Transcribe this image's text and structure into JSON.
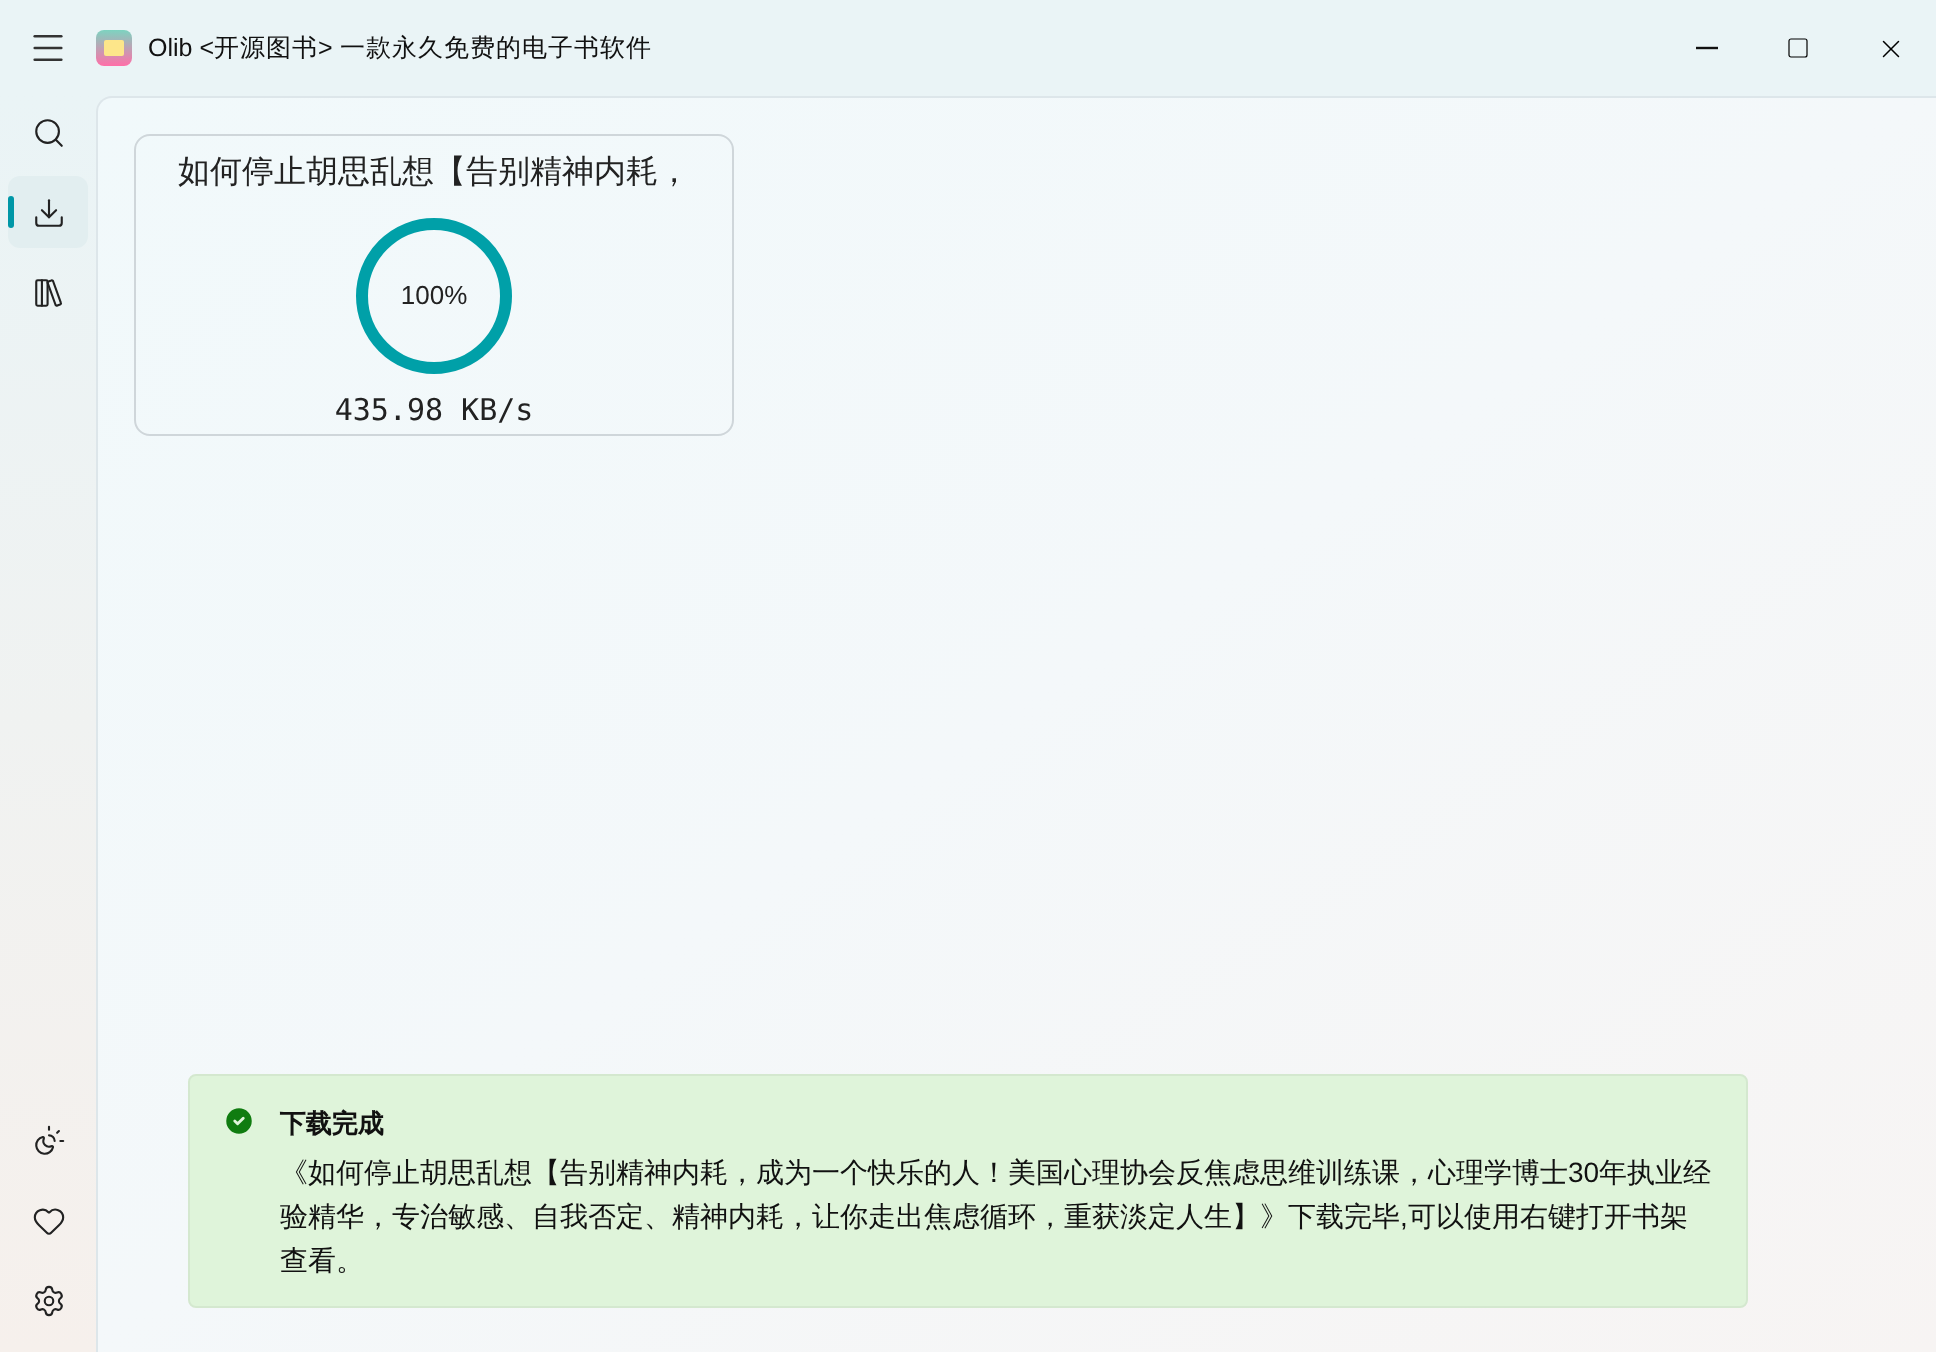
{
  "window": {
    "title": "Olib <开源图书> 一款永久免费的电子书软件"
  },
  "nav_top": [
    {
      "kind": "search",
      "selected": false
    },
    {
      "kind": "download",
      "selected": true
    },
    {
      "kind": "library",
      "selected": false
    }
  ],
  "nav_bottom": [
    {
      "kind": "theme"
    },
    {
      "kind": "favorite"
    },
    {
      "kind": "settings"
    }
  ],
  "downloads": [
    {
      "title": "如何停止胡思乱想【告别精神内耗，",
      "level": 1,
      "percent": "100%",
      "speed": "435.98 KB/s"
    }
  ],
  "toast": {
    "title": "下载完成",
    "message": "《如何停止胡思乱想【告别精神内耗，成为一个快乐的人！美国心理协会反焦虑思维训练课，心理学博士30年执业经验精华，专治敏感、自我否定、精神内耗，让你走出焦虑循环，重获淡定人生】》下载完毕,可以使用右键打开书架查看。"
  }
}
